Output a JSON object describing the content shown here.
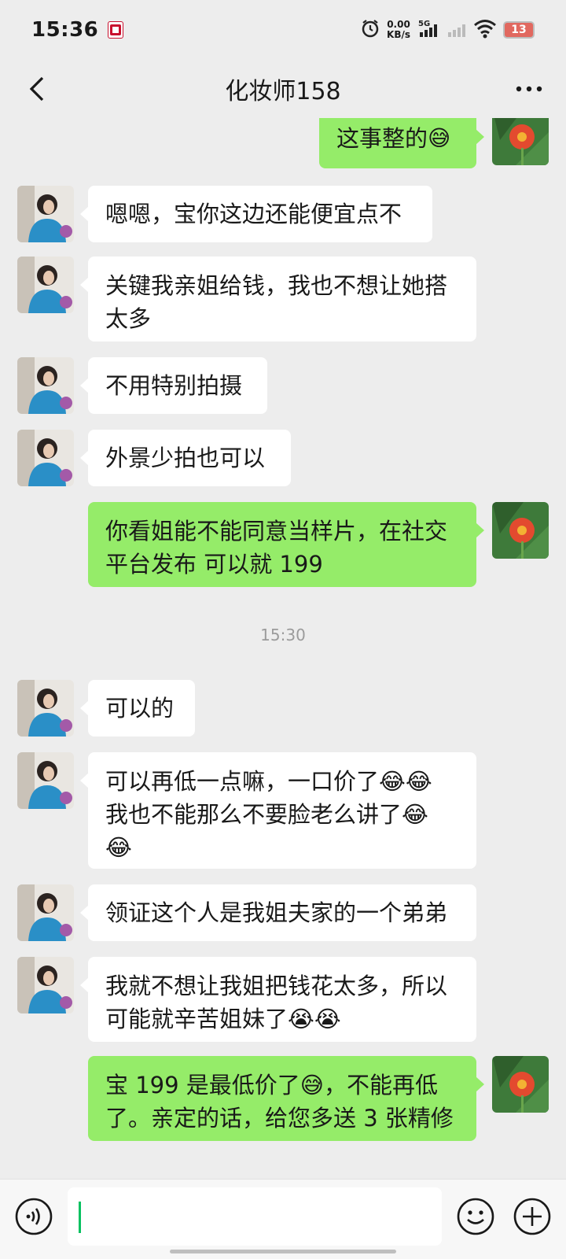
{
  "status_bar": {
    "time": "15:36",
    "app_badge": "KFC",
    "net_speed_value": "0.00",
    "net_speed_unit": "KB/s",
    "network": "5G",
    "battery": "13"
  },
  "header": {
    "title": "化妆师158"
  },
  "messages": [
    {
      "side": "out",
      "text": "这事整的",
      "emojis": [
        "😅"
      ]
    },
    {
      "side": "in",
      "text": "嗯嗯，宝你这边还能便宜点不"
    },
    {
      "side": "in",
      "lines": [
        "关键我亲姐给钱，我也不想让她搭",
        "太多"
      ]
    },
    {
      "side": "in",
      "text": "不用特别拍摄"
    },
    {
      "side": "in",
      "text": "外景少拍也可以"
    },
    {
      "side": "out",
      "lines": [
        "你看姐能不能同意当样片，在社交",
        "平台发布  可以就 199"
      ]
    },
    {
      "side": "in",
      "text": "可以的"
    },
    {
      "side": "in",
      "lines": [
        "可以再低一点嘛，一口价了😂😂",
        "我也不能那么不要脸老么讲了😂",
        "😂"
      ]
    },
    {
      "side": "in",
      "text": "领证这个人是我姐夫家的一个弟弟"
    },
    {
      "side": "in",
      "lines": [
        "我就不想让我姐把钱花太多，所以",
        "可能就辛苦姐妹了😭😭"
      ]
    },
    {
      "side": "out",
      "lines": [
        "宝  199 是最低价了😅，不能再低",
        "了。亲定的话，给您多送 3 张精修"
      ]
    }
  ],
  "timestamp": "15:30",
  "input": {
    "value": "",
    "placeholder": ""
  },
  "icons": {
    "back": "chevron-left-icon",
    "more": "more-dots-icon",
    "voice": "voice-icon",
    "emoji": "emoji-icon",
    "plus": "plus-icon"
  },
  "colors": {
    "background": "#ededed",
    "outgoing_bubble": "#95ec69",
    "incoming_bubble": "#ffffff",
    "caret": "#07c160",
    "battery": "#e1685f"
  }
}
